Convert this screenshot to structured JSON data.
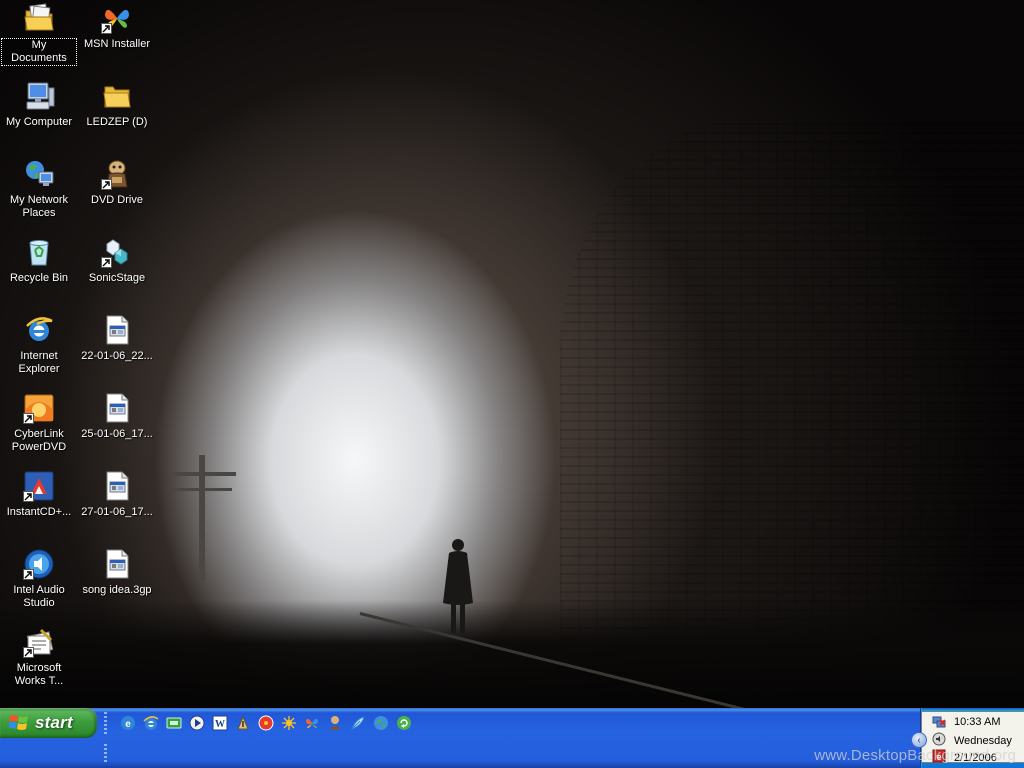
{
  "wallpaper": {
    "watermark": "www.DesktopBackground.org"
  },
  "desktop": {
    "icons": [
      {
        "label": "My Documents",
        "icon": "my-documents-icon"
      },
      {
        "label": "MSN Installer",
        "icon": "msn-butterfly-icon"
      },
      {
        "label": "My Computer",
        "icon": "my-computer-icon"
      },
      {
        "label": "LEDZEP (D)",
        "icon": "folder-icon"
      },
      {
        "label": "My Network Places",
        "icon": "network-places-icon"
      },
      {
        "label": "DVD Drive",
        "icon": "dvd-drive-icon"
      },
      {
        "label": "Recycle Bin",
        "icon": "recycle-bin-icon"
      },
      {
        "label": "SonicStage",
        "icon": "sonicstage-icon"
      },
      {
        "label": "Internet Explorer",
        "icon": "internet-explorer-icon"
      },
      {
        "label": "22-01-06_22...",
        "icon": "media-file-icon"
      },
      {
        "label": "CyberLink PowerDVD",
        "icon": "powerdvd-icon"
      },
      {
        "label": "25-01-06_17...",
        "icon": "media-file-icon"
      },
      {
        "label": "InstantCD+...",
        "icon": "instantcd-icon"
      },
      {
        "label": "27-01-06_17...",
        "icon": "media-file-icon"
      },
      {
        "label": "Intel Audio Studio",
        "icon": "intel-audio-studio-icon"
      },
      {
        "label": "song idea.3gp",
        "icon": "media-file-icon"
      },
      {
        "label": "Microsoft Works T...",
        "icon": "microsoft-works-icon"
      }
    ]
  },
  "taskbar": {
    "start_label": "start",
    "quick_launch": [
      "browser-e-icon",
      "internet-explorer-icon",
      "show-desktop-icon",
      "media-player-icon",
      "word-icon",
      "media-disc-icon",
      "network-tool-icon",
      "butterfly-icon",
      "character-icon",
      "feather-icon",
      "globe-icon",
      "refresh-globe-icon"
    ],
    "tray": {
      "time": "10:33 AM",
      "day": "Wednesday",
      "date": "2/1/2006"
    }
  },
  "colors": {
    "taskbar_blue": "#245edb",
    "start_green": "#3d9d3d",
    "tray_blue": "#0f76d8"
  }
}
